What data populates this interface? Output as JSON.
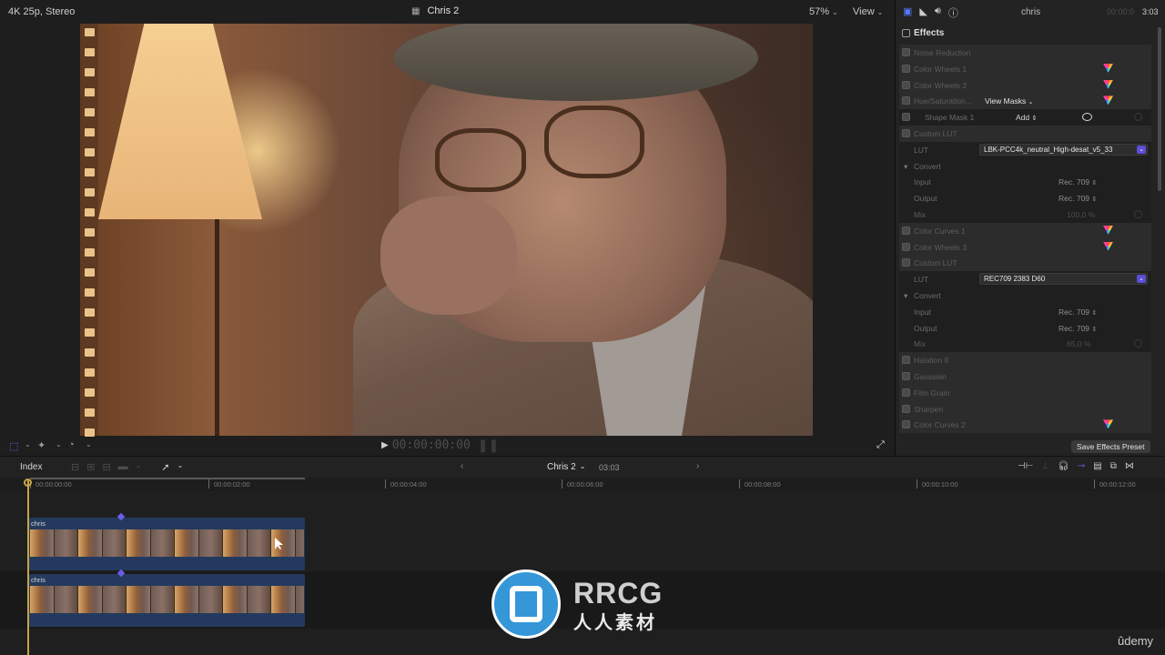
{
  "viewer": {
    "format": "4K 25p, Stereo",
    "title": "Chris 2",
    "zoom": "57%",
    "view_label": "View",
    "timecode": "00:00:00:00"
  },
  "inspector": {
    "clip_name": "chris",
    "timecode": "00:00:0",
    "duration": "3:03",
    "effects_label": "Effects",
    "view_masks_label": "View Masks",
    "add_label": "Add",
    "save_preset_label": "Save Effects Preset",
    "effects": [
      {
        "label": "Noise Reduction"
      },
      {
        "label": "Color Wheels 1"
      },
      {
        "label": "Color Wheels 2"
      },
      {
        "label": "Hue/Saturation..."
      },
      {
        "label": "Shape Mask 1"
      },
      {
        "label": "Custom LUT"
      },
      {
        "label": "LUT",
        "value": "LBK-PCC4k_neutral_High-desat_v5_33"
      },
      {
        "label": "Convert"
      },
      {
        "label": "Input",
        "value": "Rec. 709"
      },
      {
        "label": "Output",
        "value": "Rec. 709"
      },
      {
        "label": "Mix",
        "value": "100,0 %"
      },
      {
        "label": "Color Curves 1"
      },
      {
        "label": "Color Wheels 3"
      },
      {
        "label": "Custom LUT"
      },
      {
        "label": "LUT",
        "value": "REC709 2383 D60"
      },
      {
        "label": "Convert"
      },
      {
        "label": "Input",
        "value": "Rec. 709"
      },
      {
        "label": "Output",
        "value": "Rec. 709"
      },
      {
        "label": "Mix",
        "value": "65,0 %"
      },
      {
        "label": "Halation II"
      },
      {
        "label": "Gaussian"
      },
      {
        "label": "Film Grain"
      },
      {
        "label": "Sharpen"
      },
      {
        "label": "Color Curves 2"
      }
    ]
  },
  "timeline": {
    "index_label": "Index",
    "project_name": "Chris 2",
    "duration": "03:03",
    "ruler": [
      "00:00:00:00",
      "00:00:02:00",
      "00:00:04:00",
      "00:00:06:00",
      "00:00:08:00",
      "00:00:10:00",
      "00:00:12:00"
    ],
    "clips": [
      {
        "name": "chris"
      },
      {
        "name": "chris"
      }
    ]
  },
  "watermark": {
    "main": "RRCG",
    "sub": "人人素材"
  },
  "udemy": "ûdemy",
  "colors": {
    "accent": "#5b4ed6",
    "playhead": "#c7a546",
    "clip": "#233a5e",
    "marker": "#6b5ce7"
  }
}
